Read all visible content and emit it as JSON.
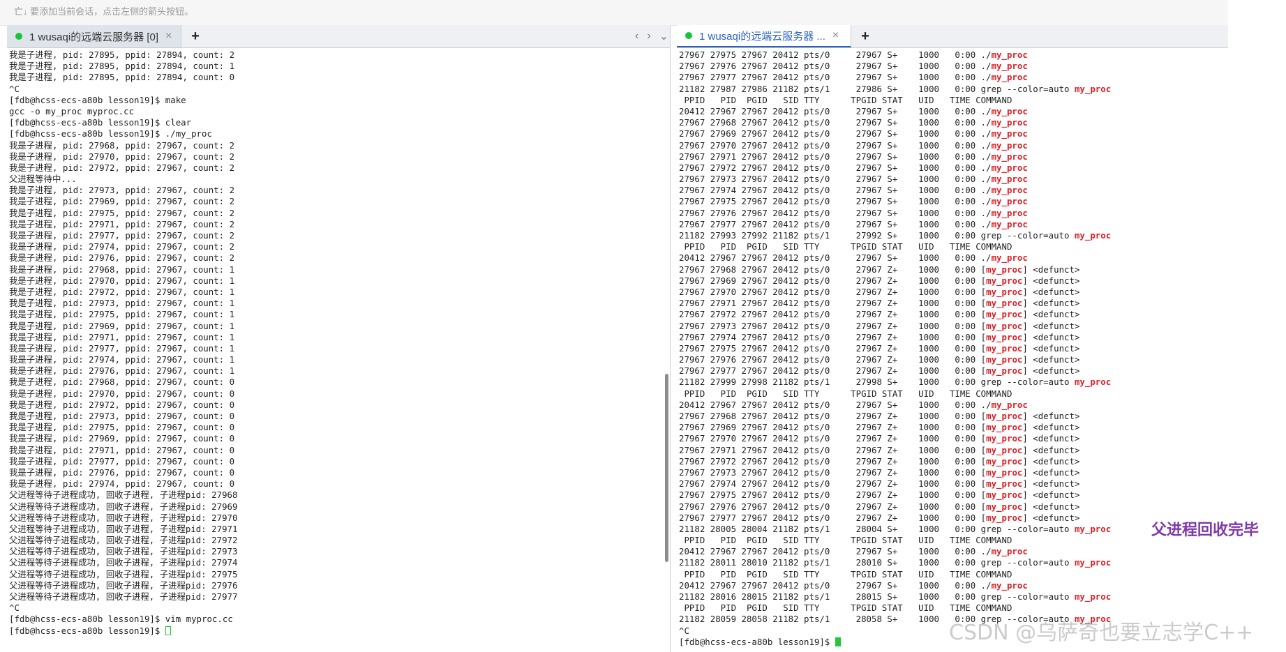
{
  "top_strip_text": "亡↓ 要添加当前会话，点击左侧的箭头按钮。",
  "left_pane": {
    "tab_title": "1 wusaqi的远端云服务器 [0]",
    "close_glyph": "×",
    "add_glyph": "+",
    "nav_prev": "‹",
    "nav_next": "›",
    "nav_menu": "⌄",
    "lines": [
      "我是子进程, pid: 27895, ppid: 27894, count: 2",
      "我是子进程, pid: 27895, ppid: 27894, count: 1",
      "我是子进程, pid: 27895, ppid: 27894, count: 0",
      "^C",
      "[fdb@hcss-ecs-a80b lesson19]$ make",
      "gcc -o my_proc myproc.cc",
      "[fdb@hcss-ecs-a80b lesson19]$ clear",
      "[fdb@hcss-ecs-a80b lesson19]$ ./my_proc",
      "我是子进程, pid: 27968, ppid: 27967, count: 2",
      "我是子进程, pid: 27970, ppid: 27967, count: 2",
      "我是子进程, pid: 27972, ppid: 27967, count: 2",
      "父进程等待中...",
      "我是子进程, pid: 27973, ppid: 27967, count: 2",
      "我是子进程, pid: 27969, ppid: 27967, count: 2",
      "我是子进程, pid: 27975, ppid: 27967, count: 2",
      "我是子进程, pid: 27971, ppid: 27967, count: 2",
      "我是子进程, pid: 27977, ppid: 27967, count: 2",
      "我是子进程, pid: 27974, ppid: 27967, count: 2",
      "我是子进程, pid: 27976, ppid: 27967, count: 2",
      "我是子进程, pid: 27968, ppid: 27967, count: 1",
      "我是子进程, pid: 27970, ppid: 27967, count: 1",
      "我是子进程, pid: 27972, ppid: 27967, count: 1",
      "我是子进程, pid: 27973, ppid: 27967, count: 1",
      "我是子进程, pid: 27975, ppid: 27967, count: 1",
      "我是子进程, pid: 27969, ppid: 27967, count: 1",
      "我是子进程, pid: 27971, ppid: 27967, count: 1",
      "我是子进程, pid: 27977, ppid: 27967, count: 1",
      "我是子进程, pid: 27974, ppid: 27967, count: 1",
      "我是子进程, pid: 27976, ppid: 27967, count: 1",
      "我是子进程, pid: 27968, ppid: 27967, count: 0",
      "我是子进程, pid: 27970, ppid: 27967, count: 0",
      "我是子进程, pid: 27972, ppid: 27967, count: 0",
      "我是子进程, pid: 27973, ppid: 27967, count: 0",
      "我是子进程, pid: 27975, ppid: 27967, count: 0",
      "我是子进程, pid: 27969, ppid: 27967, count: 0",
      "我是子进程, pid: 27971, ppid: 27967, count: 0",
      "我是子进程, pid: 27977, ppid: 27967, count: 0",
      "我是子进程, pid: 27976, ppid: 27967, count: 0",
      "我是子进程, pid: 27974, ppid: 27967, count: 0",
      "父进程等待子进程成功, 回收子进程, 子进程pid: 27968",
      "父进程等待子进程成功, 回收子进程, 子进程pid: 27969",
      "父进程等待子进程成功, 回收子进程, 子进程pid: 27970",
      "父进程等待子进程成功, 回收子进程, 子进程pid: 27971",
      "父进程等待子进程成功, 回收子进程, 子进程pid: 27972",
      "父进程等待子进程成功, 回收子进程, 子进程pid: 27973",
      "父进程等待子进程成功, 回收子进程, 子进程pid: 27974",
      "父进程等待子进程成功, 回收子进程, 子进程pid: 27975",
      "父进程等待子进程成功, 回收子进程, 子进程pid: 27976",
      "父进程等待子进程成功, 回收子进程, 子进程pid: 27977",
      "^C",
      "[fdb@hcss-ecs-a80b lesson19]$ vim myproc.cc",
      "[fdb@hcss-ecs-a80b lesson19]$ "
    ]
  },
  "right_pane": {
    "tab_title": "1 wusaqi的远端云服务器 ...",
    "close_glyph": "×",
    "add_glyph": "+",
    "highlight": "my_proc",
    "highlight_color": "#e01e24",
    "lines": [
      "27967 27975 27967 20412 pts/0     27967 S+    1000   0:00 ./my_proc",
      "27967 27976 27967 20412 pts/0     27967 S+    1000   0:00 ./my_proc",
      "27967 27977 27967 20412 pts/0     27967 S+    1000   0:00 ./my_proc",
      "21182 27987 27986 21182 pts/1     27986 S+    1000   0:00 grep --color=auto my_proc",
      " PPID   PID  PGID   SID TTY      TPGID STAT   UID   TIME COMMAND",
      "20412 27967 27967 20412 pts/0     27967 S+    1000   0:00 ./my_proc",
      "27967 27968 27967 20412 pts/0     27967 S+    1000   0:00 ./my_proc",
      "27967 27969 27967 20412 pts/0     27967 S+    1000   0:00 ./my_proc",
      "27967 27970 27967 20412 pts/0     27967 S+    1000   0:00 ./my_proc",
      "27967 27971 27967 20412 pts/0     27967 S+    1000   0:00 ./my_proc",
      "27967 27972 27967 20412 pts/0     27967 S+    1000   0:00 ./my_proc",
      "27967 27973 27967 20412 pts/0     27967 S+    1000   0:00 ./my_proc",
      "27967 27974 27967 20412 pts/0     27967 S+    1000   0:00 ./my_proc",
      "27967 27975 27967 20412 pts/0     27967 S+    1000   0:00 ./my_proc",
      "27967 27976 27967 20412 pts/0     27967 S+    1000   0:00 ./my_proc",
      "27967 27977 27967 20412 pts/0     27967 S+    1000   0:00 ./my_proc",
      "21182 27993 27992 21182 pts/1     27992 S+    1000   0:00 grep --color=auto my_proc",
      " PPID   PID  PGID   SID TTY      TPGID STAT   UID   TIME COMMAND",
      "20412 27967 27967 20412 pts/0     27967 S+    1000   0:00 ./my_proc",
      "27967 27968 27967 20412 pts/0     27967 Z+    1000   0:00 [my_proc] <defunct>",
      "27967 27969 27967 20412 pts/0     27967 Z+    1000   0:00 [my_proc] <defunct>",
      "27967 27970 27967 20412 pts/0     27967 Z+    1000   0:00 [my_proc] <defunct>",
      "27967 27971 27967 20412 pts/0     27967 Z+    1000   0:00 [my_proc] <defunct>",
      "27967 27972 27967 20412 pts/0     27967 Z+    1000   0:00 [my_proc] <defunct>",
      "27967 27973 27967 20412 pts/0     27967 Z+    1000   0:00 [my_proc] <defunct>",
      "27967 27974 27967 20412 pts/0     27967 Z+    1000   0:00 [my_proc] <defunct>",
      "27967 27975 27967 20412 pts/0     27967 Z+    1000   0:00 [my_proc] <defunct>",
      "27967 27976 27967 20412 pts/0     27967 Z+    1000   0:00 [my_proc] <defunct>",
      "27967 27977 27967 20412 pts/0     27967 Z+    1000   0:00 [my_proc] <defunct>",
      "21182 27999 27998 21182 pts/1     27998 S+    1000   0:00 grep --color=auto my_proc",
      " PPID   PID  PGID   SID TTY      TPGID STAT   UID   TIME COMMAND",
      "20412 27967 27967 20412 pts/0     27967 S+    1000   0:00 ./my_proc",
      "27967 27968 27967 20412 pts/0     27967 Z+    1000   0:00 [my_proc] <defunct>",
      "27967 27969 27967 20412 pts/0     27967 Z+    1000   0:00 [my_proc] <defunct>",
      "27967 27970 27967 20412 pts/0     27967 Z+    1000   0:00 [my_proc] <defunct>",
      "27967 27971 27967 20412 pts/0     27967 Z+    1000   0:00 [my_proc] <defunct>",
      "27967 27972 27967 20412 pts/0     27967 Z+    1000   0:00 [my_proc] <defunct>",
      "27967 27973 27967 20412 pts/0     27967 Z+    1000   0:00 [my_proc] <defunct>",
      "27967 27974 27967 20412 pts/0     27967 Z+    1000   0:00 [my_proc] <defunct>",
      "27967 27975 27967 20412 pts/0     27967 Z+    1000   0:00 [my_proc] <defunct>",
      "27967 27976 27967 20412 pts/0     27967 Z+    1000   0:00 [my_proc] <defunct>",
      "27967 27977 27967 20412 pts/0     27967 Z+    1000   0:00 [my_proc] <defunct>",
      "21182 28005 28004 21182 pts/1     28004 S+    1000   0:00 grep --color=auto my_proc",
      " PPID   PID  PGID   SID TTY      TPGID STAT   UID   TIME COMMAND",
      "20412 27967 27967 20412 pts/0     27967 S+    1000   0:00 ./my_proc",
      "21182 28011 28010 21182 pts/1     28010 S+    1000   0:00 grep --color=auto my_proc",
      " PPID   PID  PGID   SID TTY      TPGID STAT   UID   TIME COMMAND",
      "20412 27967 27967 20412 pts/0     27967 S+    1000   0:00 ./my_proc",
      "21182 28016 28015 21182 pts/1     28015 S+    1000   0:00 grep --color=auto my_proc",
      " PPID   PID  PGID   SID TTY      TPGID STAT   UID   TIME COMMAND",
      "21182 28059 28058 21182 pts/1     28058 S+    1000   0:00 grep --color=auto my_proc",
      "^C",
      "[fdb@hcss-ecs-a80b lesson19]$ "
    ]
  },
  "annotation": "父进程回收完毕",
  "watermark": "CSDN @乌萨奇也要立志学C++"
}
